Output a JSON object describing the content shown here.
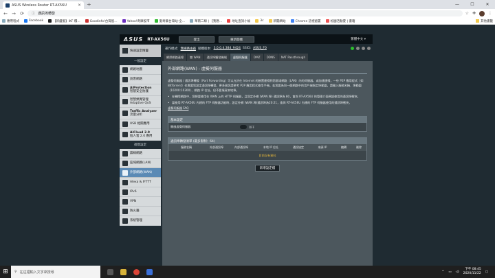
{
  "browser": {
    "tab_title": "ASUS Wireless Router RT-AX56U",
    "tab_close": "×",
    "new_tab": "+",
    "window_controls": [
      "—",
      "☐",
      "✕"
    ],
    "address": "通訊埠轉發",
    "nav": [
      "←",
      "→",
      "⟳"
    ],
    "bookmarks": [
      "應用程式",
      "Facebook",
      "【新盧服】iKF 積...",
      "Goodinfo!台灣股...",
      "Yahoo!奇摩股市",
      "愛奇藝台灣站-全...",
      "華南二線 | 【我匯...",
      "地址查詢小偷",
      "3c",
      "新聞網站",
      "Chrome 這裡處置",
      "松園活動夏 | 書籍"
    ],
    "bookmarks_right": "其他書籤"
  },
  "router": {
    "logo": "ASUS",
    "model": "RT-AX56U",
    "top_buttons": [
      "登出",
      "重新開機"
    ],
    "language": "繁體中文",
    "quick_setup": "快速設定精靈",
    "general_header": "一般設定",
    "general_menu": [
      {
        "label": "網路地圖",
        "sub": ""
      },
      {
        "label": "訪客網路",
        "sub": ""
      },
      {
        "label": "AiProtection",
        "sub": "智慧安全防護"
      },
      {
        "label": "智慧頻寬管理 Adaptive QoS",
        "sub": ""
      },
      {
        "label": "Traffic Analyzer",
        "sub": "流量分析"
      },
      {
        "label": "USB 相關應用",
        "sub": ""
      },
      {
        "label": "AiCloud 2.0",
        "sub": "個人雲 2.0 應用"
      }
    ],
    "advanced_header": "進階設定",
    "advanced_menu": [
      "無線網路",
      "區域網路(LAN)",
      "外部網路(WAN)",
      "Alexa & IFTTT",
      "IPv6",
      "VPN",
      "防火牆",
      "系統管理"
    ],
    "info": {
      "mode_label": "運作模式:",
      "mode_value": "無線路由器",
      "fw_label": "韌體版本:",
      "fw_value": "3.0.0.4.384_9424",
      "ssid_label": "SSID:",
      "ssid_value": "ASUS_F0"
    },
    "tabs": [
      "網際網路連線",
      "雙 WAN",
      "通訊埠觸發機制",
      "虛擬伺服器",
      "DMZ",
      "DDNS",
      "NAT Passthrough"
    ],
    "active_tab": 3,
    "panel_title": "外部網路(WAN) - 虛擬伺服器",
    "description": "虛擬伺服器 / 通訊埠轉發（Port Forwarding）可以允許在 Internet 的裝置連線到您區域網路（LAN）內的伺服器，或加速連線，一些 P2P 應用程式（如 BitTorrent）也需要您設定通訊埠轉發。更多資訊請參考 P2P 應用程式使用手冊。若您要為同一個網路中的用戶端指定埠範圍，請輸入服務名稱、埠範圍（10200:10300）、網路 IP 位址，但不要填寫本地埠。",
    "bullets": [
      "在轉際網路中，您想要使用在 WAN 上的 HTTP 伺服器，且您定外網 (WAN 埠) 通訊埠為 80，會與 RT-AX56U 的管理介面預設使用的通訊埠衝突。",
      "當使用 RT-AX56U 內建的 FTP 伺服器功能時，設定外網 (WAN 埠)通訊埠為20:21，會與 RT-AX56U 內建的 FTP 伺服器使用的通訊埠衝突。"
    ],
    "faq_link": "虛擬伺服器 FAQ",
    "basic_header": "基本設定",
    "enable_label": "開啟虛擬伺服器",
    "enable_state": "OFF",
    "list_header": "通訊埠轉發清單 (最多限制：64)",
    "columns": [
      "服務名稱",
      "外部通訊埠",
      "內部通訊埠",
      "本地 IP 位址",
      "通訊協定",
      "來源 IP",
      "編輯",
      "刪除"
    ],
    "empty_text": "目前沒有資料",
    "add_button": "新增設定檔"
  },
  "taskbar": {
    "search_placeholder": "在這裡輸入文字來搜尋",
    "time": "下午 08:45",
    "date": "2020/11/22"
  },
  "colors": {
    "page_bg": "#1f2b32",
    "panel_bg": "#4c575d",
    "active_menu": "#5b8ab5",
    "empty_text": "#e1b43c"
  }
}
